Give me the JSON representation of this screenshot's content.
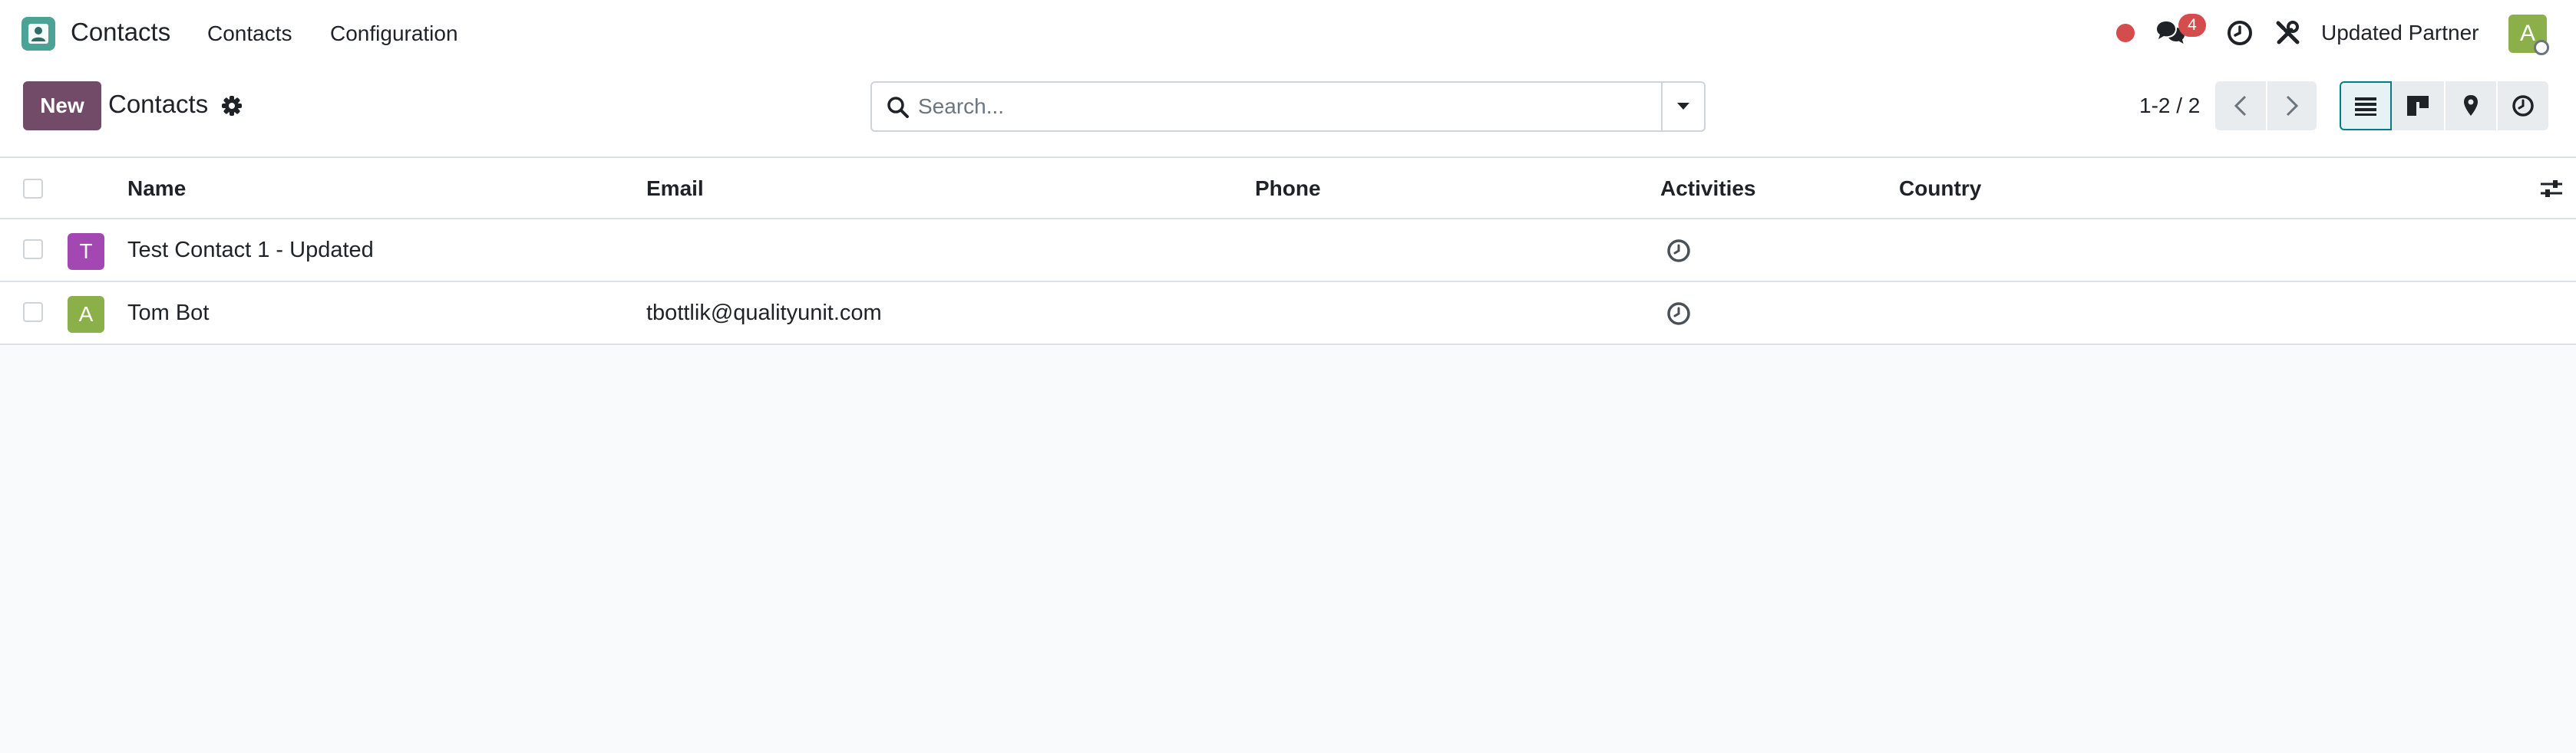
{
  "navbar": {
    "app_title": "Contacts",
    "menu": [
      {
        "label": "Contacts"
      },
      {
        "label": "Configuration"
      }
    ],
    "chat_badge_count": "4",
    "user_name": "Updated Partner",
    "user_avatar_letter": "A"
  },
  "control_panel": {
    "new_label": "New",
    "title": "Contacts",
    "search_placeholder": "Search...",
    "pager": "1-2 / 2"
  },
  "list": {
    "columns": [
      "Name",
      "Email",
      "Phone",
      "Activities",
      "Country"
    ],
    "rows": [
      {
        "avatar_letter": "T",
        "avatar_color": "#a348b3",
        "name": "Test Contact 1 - Updated",
        "email": "",
        "phone": "",
        "country": ""
      },
      {
        "avatar_letter": "A",
        "avatar_color": "#8bb04a",
        "name": "Tom Bot",
        "email": "tbottlik@qualityunit.com",
        "phone": "",
        "country": ""
      }
    ]
  },
  "colors": {
    "brand": "#714b67",
    "accent": "#017e84",
    "badge": "#d44c4c"
  }
}
